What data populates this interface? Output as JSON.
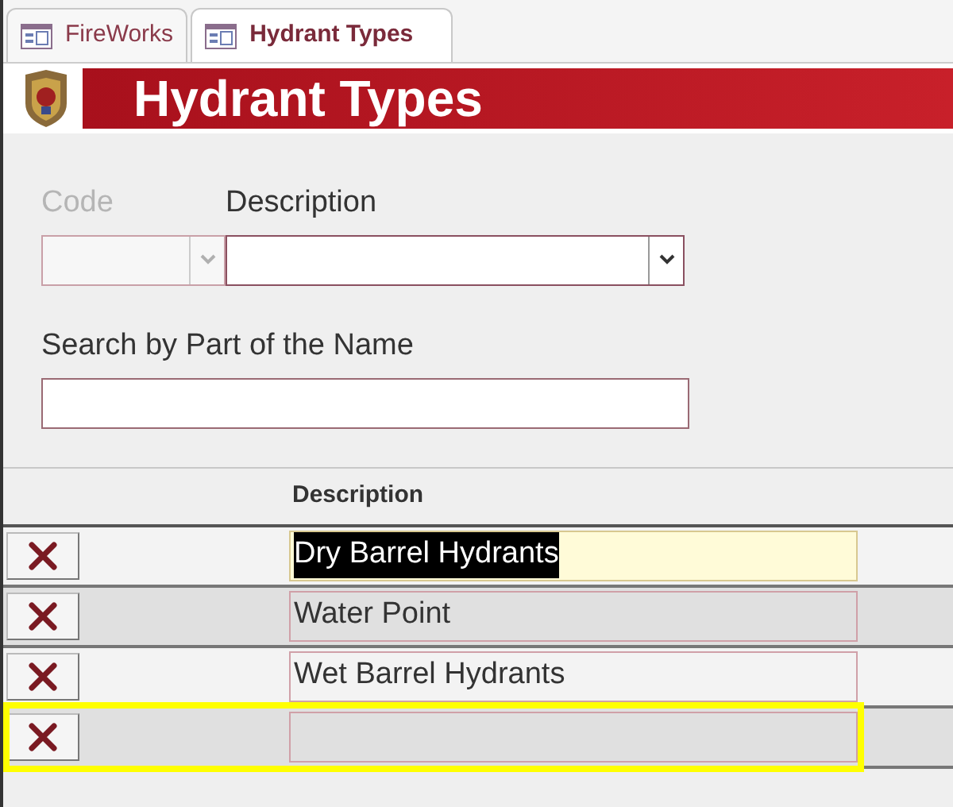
{
  "tabs": [
    {
      "label": "FireWorks",
      "selected": false
    },
    {
      "label": "Hydrant Types",
      "selected": true
    }
  ],
  "header": {
    "title": "Hydrant Types"
  },
  "filters": {
    "code": {
      "label": "Code",
      "disabled": true
    },
    "description": {
      "label": "Description"
    },
    "search": {
      "label": "Search by Part of the Name"
    }
  },
  "list": {
    "column": "Description",
    "rows": [
      {
        "description": "Dry Barrel Hydrants",
        "selected": true,
        "highlighted": false
      },
      {
        "description": "Water Point",
        "selected": false,
        "highlighted": false
      },
      {
        "description": "Wet Barrel Hydrants",
        "selected": false,
        "highlighted": false
      },
      {
        "selected": false,
        "highlighted": true
      }
    ]
  }
}
